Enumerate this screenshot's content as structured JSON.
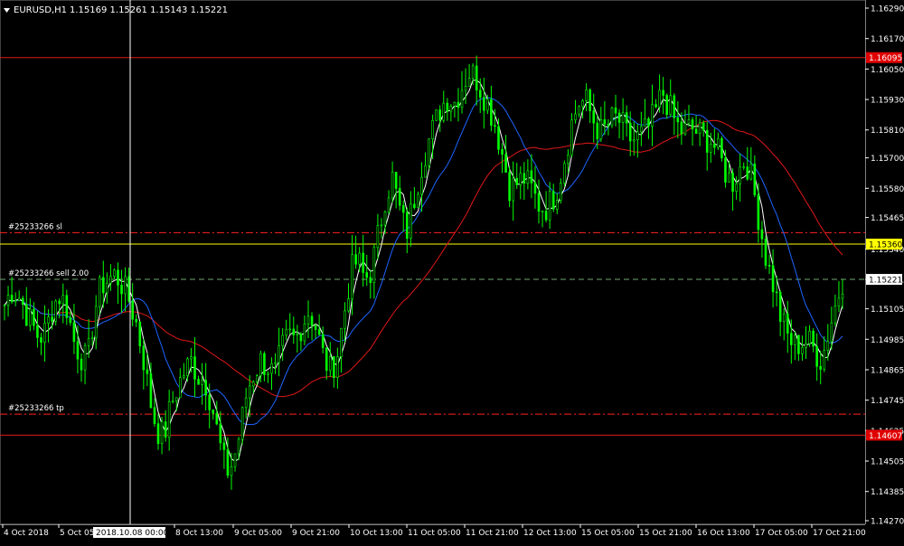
{
  "header": {
    "symbol_timeframe": "EURUSD,H1",
    "ohlc": "1.15169 1.15261 1.15143 1.15221"
  },
  "colors": {
    "background": "#000000",
    "bull_candle": "#00ff00",
    "bear_candle": "#00ff00",
    "ma_fast": "#ffffff",
    "ma_mid": "#1e64ff",
    "ma_slow": "#e01818",
    "order_line": "#ff2020",
    "current_price_line": "#6fa86f",
    "yellow_level": "#ffff00",
    "horizontal_red": "#e01818",
    "axis_text": "#ffffff",
    "price_badge_red": "#e00000",
    "price_badge_yellow": "#ffff00"
  },
  "price_axis": {
    "ticks": [
      "1.16290",
      "1.16170",
      "1.16050",
      "1.15930",
      "1.15810",
      "1.15700",
      "1.15580",
      "1.15465",
      "1.15340",
      "1.15221",
      "1.15105",
      "1.14985",
      "1.14865",
      "1.14745",
      "1.14625",
      "1.14505",
      "1.14385",
      "1.14270"
    ],
    "ymin": 1.1427,
    "ymax": 1.1629
  },
  "time_axis": {
    "labels": [
      "4 Oct 2018",
      "5 Oct 05",
      "8 Oct 13:00",
      "9 Oct 05:00",
      "9 Oct 21:00",
      "10 Oct 13:00",
      "11 Oct 05:00",
      "11 Oct 21:00",
      "12 Oct 13:00",
      "15 Oct 05:00",
      "15 Oct 21:00",
      "16 Oct 13:00",
      "17 Oct 05:00",
      "17 Oct 21:00"
    ],
    "crosshair_label": "2018.10.08 00:00"
  },
  "levels": [
    {
      "name": "red-level-top",
      "price": 1.16095,
      "badge": "1.16095",
      "badge_style": "red",
      "line": "solid-red"
    },
    {
      "name": "order-sl",
      "price": 1.15405,
      "label": "#25233266 sl",
      "line": "dashdot-red"
    },
    {
      "name": "yellow-level",
      "price": 1.1536,
      "badge": "1.15360",
      "badge_style": "yellow",
      "line": "solid-yellow"
    },
    {
      "name": "order-sell",
      "price": 1.15221,
      "label": "#25233266 sell 2.00",
      "badge": "1.15221",
      "badge_style": "white",
      "line": "dashed-green"
    },
    {
      "name": "order-tp",
      "price": 1.1469,
      "label": "#25233266 tp",
      "line": "dashdot-red"
    },
    {
      "name": "red-level-bottom",
      "price": 1.14607,
      "badge": "1.14607",
      "badge_style": "red",
      "line": "solid-red"
    }
  ],
  "chart_data": {
    "type": "candlestick",
    "symbol": "EURUSD",
    "timeframe": "H1",
    "close_path": [
      1.1512,
      1.1518,
      1.1516,
      1.151,
      1.1504,
      1.1499,
      1.1502,
      1.1512,
      1.1516,
      1.1511,
      1.1498,
      1.1492,
      1.149,
      1.151,
      1.152,
      1.1522,
      1.1524,
      1.152,
      1.1514,
      1.1505,
      1.1492,
      1.1475,
      1.1463,
      1.146,
      1.1472,
      1.148,
      1.1486,
      1.149,
      1.1484,
      1.1482,
      1.1472,
      1.1458,
      1.1446,
      1.145,
      1.1462,
      1.1478,
      1.1485,
      1.149,
      1.1488,
      1.1484,
      1.1494,
      1.15,
      1.1498,
      1.1505,
      1.151,
      1.1503,
      1.1492,
      1.1486,
      1.1492,
      1.1508,
      1.1525,
      1.153,
      1.1522,
      1.1526,
      1.154,
      1.1555,
      1.1562,
      1.155,
      1.154,
      1.1552,
      1.1565,
      1.1575,
      1.1582,
      1.159,
      1.1594,
      1.1592,
      1.1598,
      1.1604,
      1.1602,
      1.1596,
      1.159,
      1.1582,
      1.157,
      1.1558,
      1.156,
      1.1562,
      1.1558,
      1.1552,
      1.155,
      1.1553,
      1.156,
      1.1572,
      1.1585,
      1.1592,
      1.1592,
      1.1585,
      1.158,
      1.1582,
      1.1586,
      1.1584,
      1.1578,
      1.1577,
      1.1579,
      1.1582,
      1.1588,
      1.1596,
      1.159,
      1.1583,
      1.158,
      1.1582,
      1.158,
      1.1578,
      1.1577,
      1.1572,
      1.1565,
      1.156,
      1.1565,
      1.157,
      1.156,
      1.1545,
      1.153,
      1.152,
      1.1508,
      1.15,
      1.1496,
      1.1497,
      1.1498,
      1.1494,
      1.149,
      1.1502,
      1.1512,
      1.1522
    ]
  }
}
